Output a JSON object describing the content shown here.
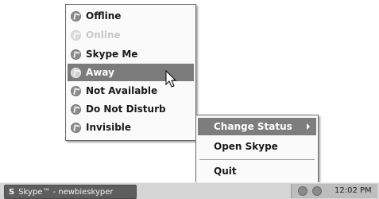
{
  "status_menu": {
    "items": [
      {
        "label": "Offline",
        "icon": "offline-icon",
        "state": "normal"
      },
      {
        "label": "Online",
        "icon": "online-icon",
        "state": "disabled"
      },
      {
        "label": "Skype Me",
        "icon": "skype-me-icon",
        "state": "normal"
      },
      {
        "label": "Away",
        "icon": "away-icon",
        "state": "selected"
      },
      {
        "label": "Not Available",
        "icon": "not-available-icon",
        "state": "normal"
      },
      {
        "label": "Do Not Disturb",
        "icon": "do-not-disturb-icon",
        "state": "normal"
      },
      {
        "label": "Invisible",
        "icon": "invisible-icon",
        "state": "normal"
      }
    ]
  },
  "context_menu": {
    "change_status": "Change Status",
    "open_skype": "Open Skype",
    "quit": "Quit"
  },
  "taskbar": {
    "task_label": "Skype™ - newbieskyper",
    "clock": "12:02 PM"
  },
  "colors": {
    "highlight": "#7b7b7b",
    "menu_bg": "#fafafa",
    "taskbar_bg": "#d6d6d6"
  }
}
